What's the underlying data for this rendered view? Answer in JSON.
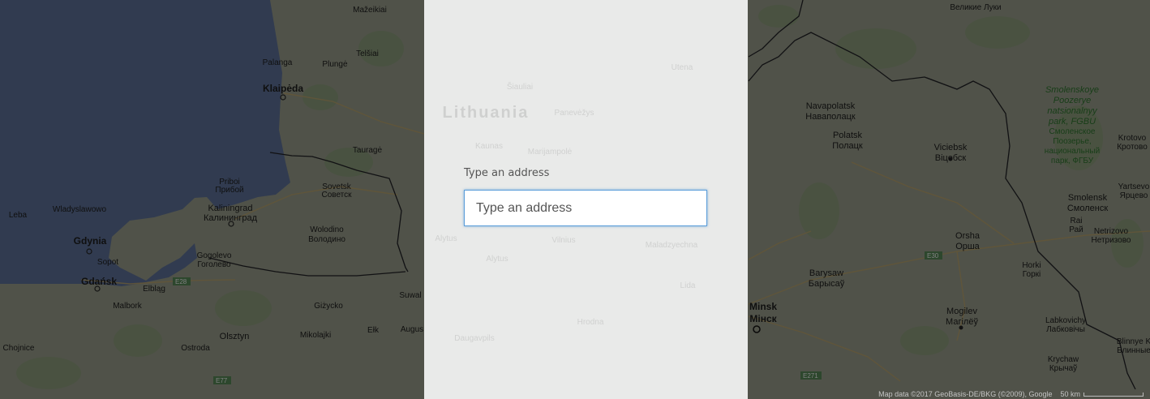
{
  "map": {
    "country_label": "Lithuania",
    "places": [
      {
        "id": "mazeikiai",
        "name": "Mažeikiai",
        "alt": ""
      },
      {
        "id": "palanga",
        "name": "Palanga",
        "alt": ""
      },
      {
        "id": "plunge",
        "name": "Plungė",
        "alt": ""
      },
      {
        "id": "telsiai",
        "name": "Telšiai",
        "alt": ""
      },
      {
        "id": "klaipeda",
        "name": "Klaipėda",
        "alt": ""
      },
      {
        "id": "taurage",
        "name": "Tauragė",
        "alt": ""
      },
      {
        "id": "priboi",
        "name": "Priboi",
        "alt": "Прибой"
      },
      {
        "id": "sovetsk",
        "name": "Sovetsk",
        "alt": "Советск"
      },
      {
        "id": "kaliningrad",
        "name": "Kaliningrad",
        "alt": "Калининград"
      },
      {
        "id": "wolodino",
        "name": "Wolodino",
        "alt": "Володино"
      },
      {
        "id": "leba",
        "name": "Leba",
        "alt": ""
      },
      {
        "id": "wladyslawowo",
        "name": "Wladyslawowo",
        "alt": ""
      },
      {
        "id": "gdynia",
        "name": "Gdynia",
        "alt": ""
      },
      {
        "id": "sopot",
        "name": "Sopot",
        "alt": ""
      },
      {
        "id": "gdansk",
        "name": "Gdańsk",
        "alt": ""
      },
      {
        "id": "elblag",
        "name": "Elbląg",
        "alt": ""
      },
      {
        "id": "gogolevo",
        "name": "Gogolevo",
        "alt": "Гоголево"
      },
      {
        "id": "malbork",
        "name": "Malbork",
        "alt": ""
      },
      {
        "id": "gizycko",
        "name": "Giżycko",
        "alt": ""
      },
      {
        "id": "suwalki",
        "name": "Suwal",
        "alt": ""
      },
      {
        "id": "elk",
        "name": "Ełk",
        "alt": ""
      },
      {
        "id": "augustow",
        "name": "Augus",
        "alt": ""
      },
      {
        "id": "olsztyn",
        "name": "Olsztyn",
        "alt": ""
      },
      {
        "id": "mikolajki",
        "name": "Mikolajki",
        "alt": ""
      },
      {
        "id": "chojnice",
        "name": "Chojnice",
        "alt": ""
      },
      {
        "id": "ostroda",
        "name": "Ostroda",
        "alt": ""
      },
      {
        "id": "velikie-luki",
        "name": "Великие Луки",
        "alt": ""
      },
      {
        "id": "navapolatsk",
        "name": "Navapolatsk",
        "alt": "Наваполацк"
      },
      {
        "id": "polatsk",
        "name": "Polatsk",
        "alt": "Полацк"
      },
      {
        "id": "viciebsk",
        "name": "Viciebsk",
        "alt": "Віцебск"
      },
      {
        "id": "smolensk",
        "name": "Smolensk",
        "alt": "Смоленск"
      },
      {
        "id": "orsha",
        "name": "Orsha",
        "alt": "Орша"
      },
      {
        "id": "barysaw",
        "name": "Barysaw",
        "alt": "Барысаў"
      },
      {
        "id": "minsk",
        "name": "Minsk",
        "alt": "Мінск"
      },
      {
        "id": "mogilev",
        "name": "Mogilev",
        "alt": "Магілёў"
      },
      {
        "id": "horki",
        "name": "Horki",
        "alt": "Горкі"
      },
      {
        "id": "labkovichy",
        "name": "Labkovichy",
        "alt": "Лабковічы"
      },
      {
        "id": "krychaw",
        "name": "Krychaw",
        "alt": "Крычаў"
      },
      {
        "id": "krotovo",
        "name": "Krotovo",
        "alt": "Кротово"
      },
      {
        "id": "yartsevo",
        "name": "Yartsevo",
        "alt": "Ярцево"
      },
      {
        "id": "netrizovo",
        "name": "Netrizovo",
        "alt": "Нетризово"
      },
      {
        "id": "rai",
        "name": "Rai",
        "alt": "Рай"
      },
      {
        "id": "klimovo",
        "name": "Blinnye K",
        "alt": "Блинные"
      }
    ],
    "park": {
      "name_lines": [
        "Smolenskoye",
        "Poozerye",
        "natsionalnyy",
        "park, FGBU"
      ],
      "alt_lines": [
        "Смоленское",
        "Поозерье,",
        "национальный",
        "парк, ФГБУ"
      ]
    },
    "roads": [
      {
        "id": "e28",
        "label": "E28"
      },
      {
        "id": "e77",
        "label": "E77"
      },
      {
        "id": "e30",
        "label": "E30"
      },
      {
        "id": "e271",
        "label": "E271"
      }
    ],
    "faded_under_panel": [
      "Lithuania",
      "Vilnius",
      "Kaunas",
      "Šiauliai",
      "Panevėžys",
      "Alytus",
      "Marijampolė",
      "Utena",
      "Daugavpils",
      "Lida",
      "Hrodna",
      "Maladzyechna"
    ],
    "attribution": "Map data ©2017 GeoBasis-DE/BKG (©2009), Google",
    "scale": "50 km",
    "colors": {
      "sea": "#2e3b52",
      "land": "#4e5145",
      "forest": "#4a5a3f",
      "border": "#1e1e22",
      "dim_overlay": "rgba(0,0,0,0.42)"
    }
  },
  "panel": {
    "label": "Type an address",
    "input_value": "",
    "input_placeholder": "Type an address",
    "accent_color": "#5b9dd9"
  }
}
